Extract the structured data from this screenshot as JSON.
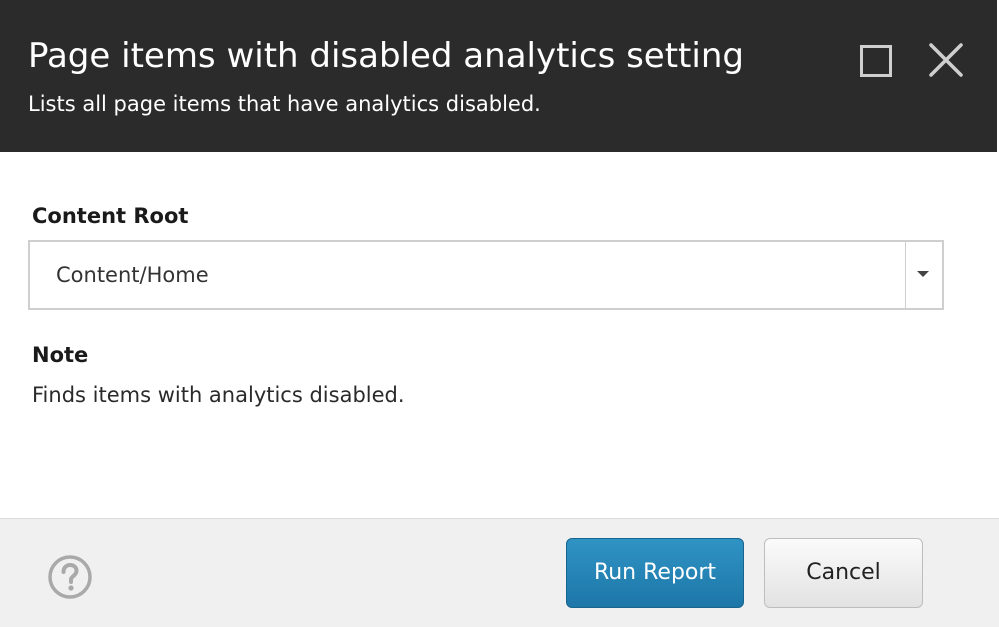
{
  "dialog": {
    "title": "Page items with disabled analytics setting",
    "subtitle": "Lists all page items that have analytics disabled.",
    "maximize_icon": "maximize-icon",
    "close_icon": "close-icon"
  },
  "form": {
    "content_root_label": "Content Root",
    "content_root_value": "Content/Home",
    "dropdown_icon": "chevron-down-icon",
    "note_label": "Note",
    "note_text": "Finds items with analytics disabled."
  },
  "footer": {
    "help_icon": "help-icon",
    "run_report_label": "Run Report",
    "cancel_label": "Cancel"
  },
  "colors": {
    "header_bg": "#2b2b2b",
    "primary_button": "#2584b8",
    "footer_bg": "#f0f0f0"
  }
}
